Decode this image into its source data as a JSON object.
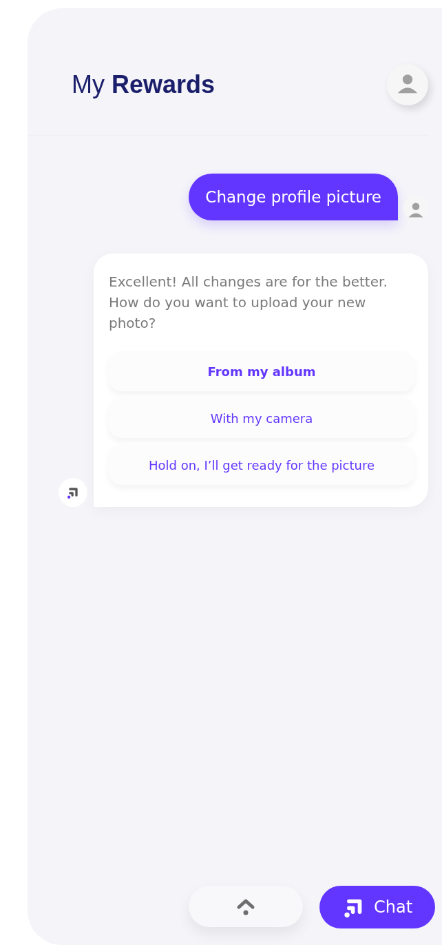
{
  "header": {
    "title_prefix": "My",
    "title": "Rewards"
  },
  "messages": [
    {
      "kind": "user",
      "text": "Change profile picture"
    },
    {
      "kind": "bot",
      "text": "Excellent! All changes are for the better. How do you want to upload your new photo?",
      "options": [
        {
          "label": "From my album",
          "selected": true
        },
        {
          "label": "With my camera",
          "selected": false
        },
        {
          "label": "Hold on, I’ll get ready for the picture",
          "selected": false
        }
      ]
    }
  ],
  "bottom_bar": {
    "chat_label": "Chat"
  }
}
